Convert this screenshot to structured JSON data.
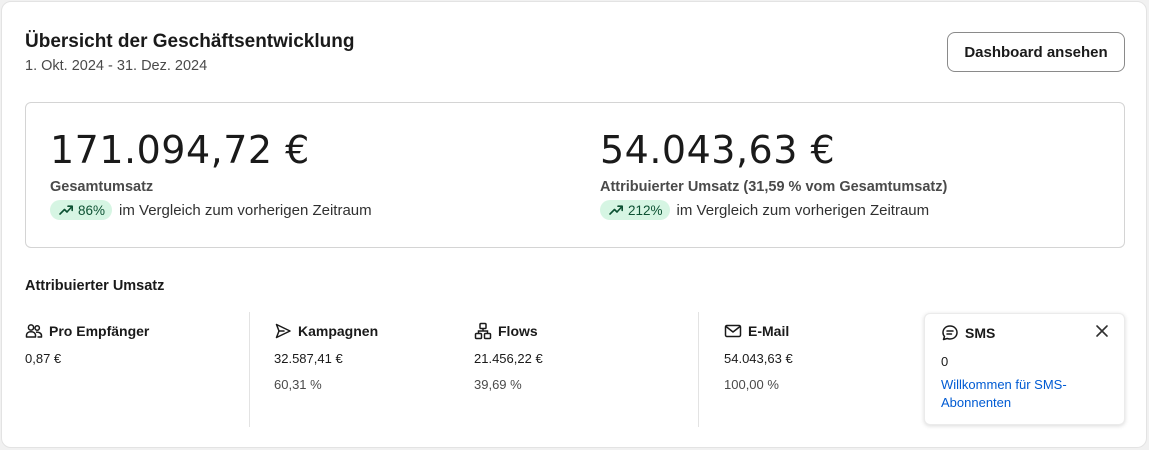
{
  "header": {
    "title": "Übersicht der Geschäftsentwicklung",
    "date_range": "1. Okt. 2024 - 31. Dez. 2024",
    "dashboard_button": "Dashboard ansehen"
  },
  "summary": {
    "total": {
      "value": "171.094,72 €",
      "label": "Gesamtumsatz",
      "change": "86%",
      "comparison": "im Vergleich zum vorherigen Zeitraum",
      "icon": "trend-up-icon"
    },
    "attributed": {
      "value": "54.043,63 €",
      "label": "Attribuierter Umsatz (31,59 % vom Gesamtumsatz)",
      "change": "212%",
      "comparison": "im Vergleich zum vorherigen Zeitraum",
      "icon": "trend-up-icon"
    }
  },
  "attributed_section": {
    "title": "Attribuierter Umsatz",
    "per_recipient": {
      "label": "Pro Empfänger",
      "value": "0,87 €",
      "icon": "people-icon"
    },
    "campaigns": {
      "label": "Kampagnen",
      "value": "32.587,41 €",
      "percent": "60,31 %",
      "icon": "send-icon"
    },
    "flows": {
      "label": "Flows",
      "value": "21.456,22 €",
      "percent": "39,69 %",
      "icon": "flow-icon"
    },
    "email": {
      "label": "E-Mail",
      "value": "54.043,63 €",
      "percent": "100,00 %",
      "icon": "envelope-icon"
    },
    "sms": {
      "label": "SMS",
      "value": "0",
      "link": "Willkommen für SMS-Abonnenten",
      "icon": "chat-icon"
    }
  },
  "colors": {
    "badge_bg": "#d6f5e3",
    "badge_text": "#0c5132",
    "link": "#005bd3"
  }
}
